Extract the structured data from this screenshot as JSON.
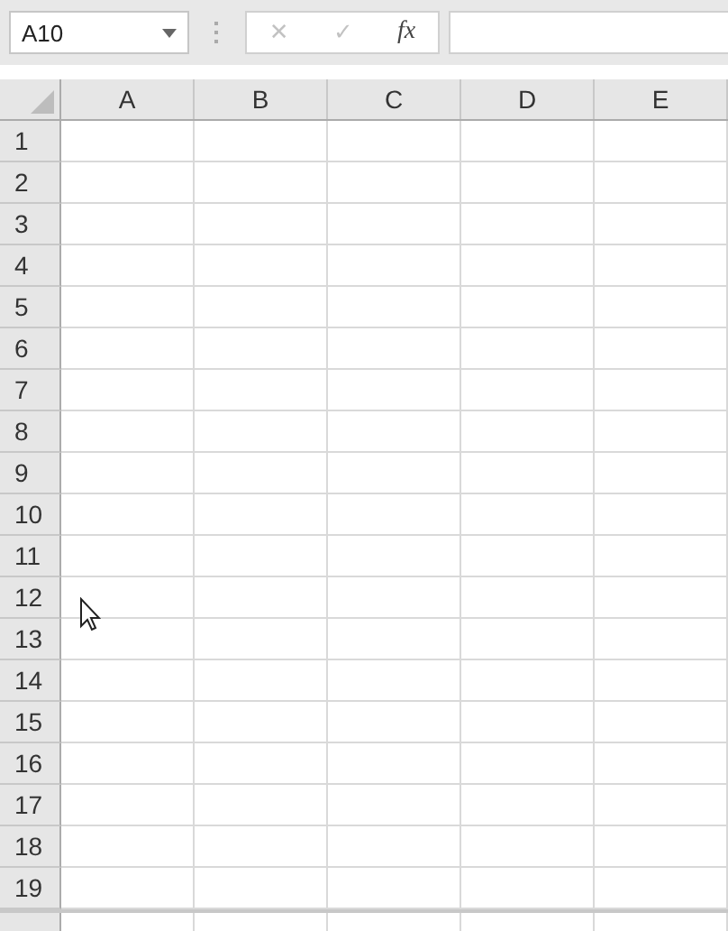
{
  "formula_bar": {
    "name_box": "A10",
    "cancel": "✕",
    "enter": "✓",
    "function": "fx"
  },
  "columns": [
    "A",
    "B",
    "C",
    "D",
    "E"
  ],
  "rows": [
    "1",
    "2",
    "3",
    "4",
    "5",
    "6",
    "7",
    "8",
    "9",
    "10",
    "11",
    "12",
    "13",
    "14",
    "15",
    "16",
    "17",
    "18",
    "19"
  ]
}
